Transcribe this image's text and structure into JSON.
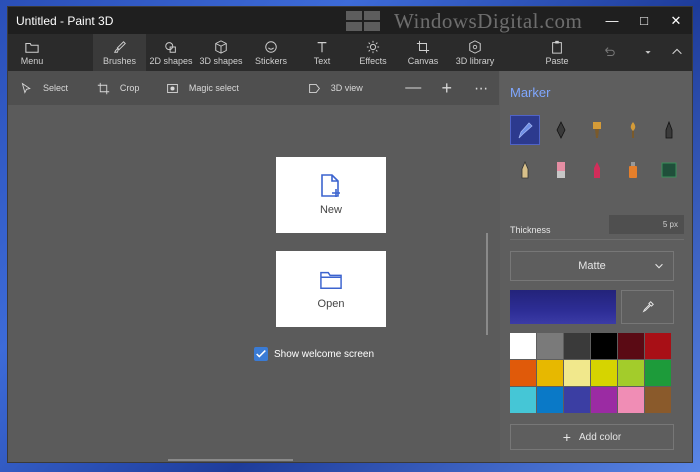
{
  "window": {
    "title": "Untitled - Paint 3D"
  },
  "watermark": {
    "text": "WindowsDigital.com"
  },
  "toolbar": {
    "items": [
      {
        "label": "Menu",
        "icon": "folder-icon"
      },
      {
        "label": "Brushes",
        "icon": "brush-icon"
      },
      {
        "label": "2D shapes",
        "icon": "shapes-2d-icon"
      },
      {
        "label": "3D shapes",
        "icon": "cube-icon"
      },
      {
        "label": "Stickers",
        "icon": "sticker-icon"
      },
      {
        "label": "Text",
        "icon": "text-icon"
      },
      {
        "label": "Effects",
        "icon": "sun-icon"
      },
      {
        "label": "Canvas",
        "icon": "crop-icon"
      },
      {
        "label": "3D library",
        "icon": "library-icon"
      }
    ],
    "paste_label": "Paste",
    "active": "Brushes"
  },
  "subbar": {
    "select_label": "Select",
    "crop_label": "Crop",
    "magic_select_label": "Magic select",
    "view_3d_label": "3D view"
  },
  "welcome": {
    "new_label": "New",
    "open_label": "Open",
    "show_welcome_label": "Show welcome screen",
    "show_welcome_checked": true
  },
  "panel": {
    "title": "Marker",
    "thickness_label": "Thickness",
    "thickness_value": "5 px",
    "finish_value": "Matte",
    "current_color": "#2b2b90",
    "add_color_label": "Add color",
    "palette": [
      "#ffffff",
      "#7a7a7a",
      "#3a3a3a",
      "#000000",
      "#5a0a14",
      "#a80f16",
      "#e05a0a",
      "#e7b800",
      "#f1e88c",
      "#d6d400",
      "#a3cc2b",
      "#1d9b3a",
      "#45c6d6",
      "#0a79c7",
      "#3b3ea3",
      "#9b2ba3",
      "#f08db5",
      "#8a5a2b"
    ]
  }
}
